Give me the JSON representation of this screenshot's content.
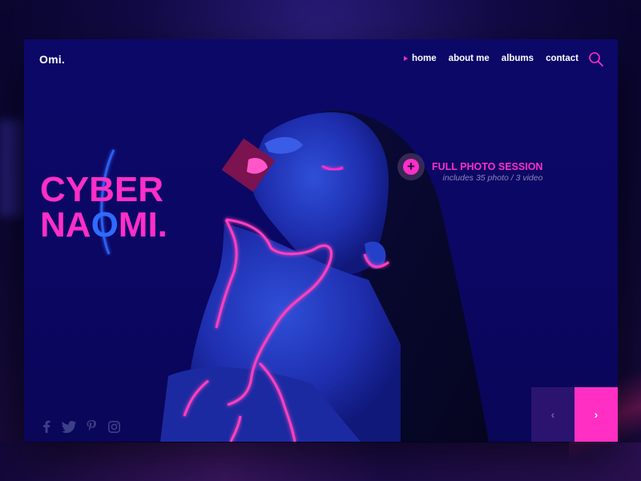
{
  "brand": {
    "logo": "Omi."
  },
  "nav": {
    "items": [
      {
        "label": "home",
        "active": true
      },
      {
        "label": "about me",
        "active": false
      },
      {
        "label": "albums",
        "active": false
      },
      {
        "label": "contact",
        "active": false
      }
    ],
    "search_icon": "search-icon"
  },
  "hero": {
    "title_line1": "CYBER",
    "title_line2_part1": "NA",
    "title_line2_o": "O",
    "title_line2_part2": "MI."
  },
  "session": {
    "button_symbol": "+",
    "title": "FULL PHOTO SESSION",
    "subtitle": "includes 35 photo / 3 video"
  },
  "social": [
    "facebook-icon",
    "twitter-icon",
    "pinterest-icon",
    "instagram-icon"
  ],
  "pager": {
    "prev_symbol": "‹",
    "next_symbol": "›"
  },
  "colors": {
    "accent": "#ff2ec8",
    "card_bg": "#0c0868",
    "highlight_blue": "#2f6bff",
    "muted_text": "#8d86b8"
  }
}
